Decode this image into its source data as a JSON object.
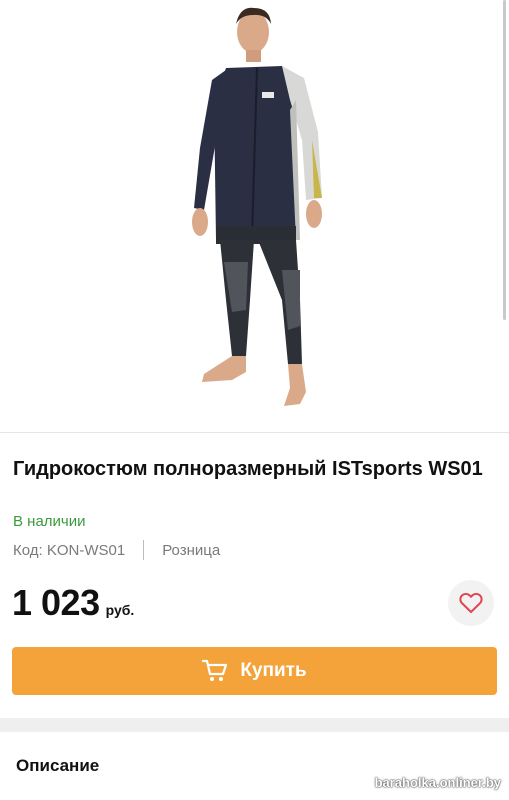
{
  "product": {
    "title": "Гидрокостюм полноразмерный ISTsports WS01",
    "availability": "В наличии",
    "code": "Код: KON-WS01",
    "sale_type": "Розница",
    "price": "1 023",
    "currency": "руб."
  },
  "actions": {
    "buy_label": "Купить",
    "buy_icon": "shopping-cart-icon",
    "favorite_icon": "heart-icon"
  },
  "description": {
    "heading": "Описание"
  },
  "watermark": "baraholka.onliner.by",
  "colors": {
    "accent": "#f3a33a",
    "in_stock": "#3a9b3a",
    "favorite": "#e0454f",
    "muted_text": "#7a7a7a"
  }
}
